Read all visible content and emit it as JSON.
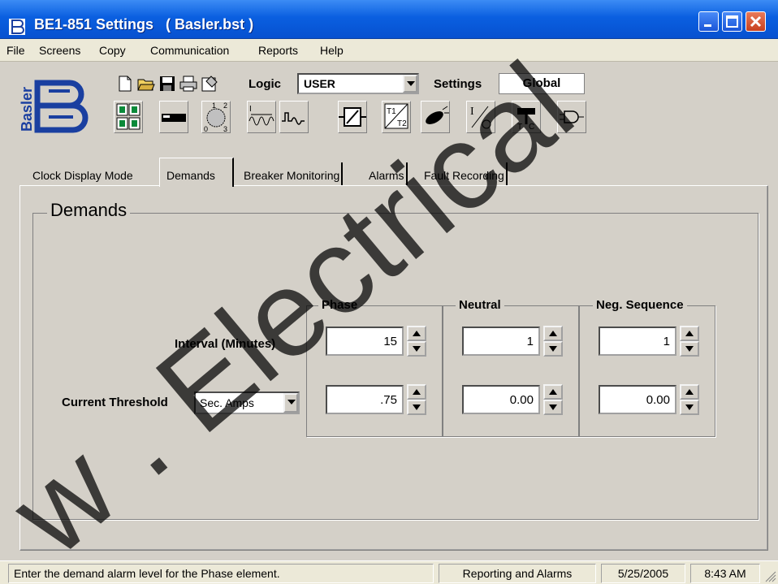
{
  "window": {
    "title": "BE1-851 Settings   ( Basler.bst )"
  },
  "menu": [
    "File",
    "Screens",
    "Copy",
    "Communication",
    "Reports",
    "Help"
  ],
  "toolbar": {
    "logo_text": "Basler",
    "logic_label": "Logic",
    "logic_value": "USER",
    "settings_label": "Settings",
    "settings_value": "Global",
    "small_icons": [
      "new-icon",
      "open-icon",
      "save-icon",
      "print-icon",
      "properties-icon"
    ],
    "big_icons": [
      "grid-icon",
      "relay-card-icon",
      "phase-rotation-icon",
      "overcurrent-icon",
      "waveform-icon",
      "transformer-icon",
      "ct-ratio-icon",
      "breaker-icon",
      "voltage-icon",
      "tc-icon",
      "logic-gate-icon"
    ]
  },
  "tabs": [
    "Clock Display Mode",
    "Demands",
    "Breaker Monitoring",
    "Alarms",
    "Fault Recording"
  ],
  "active_tab": "Demands",
  "demands": {
    "title": "Demands",
    "interval_label": "Interval (Minutes)",
    "threshold_label": "Current Threshold",
    "threshold_unit": "Sec. Amps",
    "columns": [
      {
        "name": "Phase",
        "interval": "15",
        "threshold": ".75"
      },
      {
        "name": "Neutral",
        "interval": "1",
        "threshold": "0.00"
      },
      {
        "name": "Neg. Sequence",
        "interval": "1",
        "threshold": "0.00"
      }
    ]
  },
  "status": {
    "message": "Enter the demand alarm level for the Phase element.",
    "section": "Reporting and Alarms",
    "date": "5/25/2005",
    "time": "8:43 AM"
  },
  "watermark_text": "w . Electrical"
}
